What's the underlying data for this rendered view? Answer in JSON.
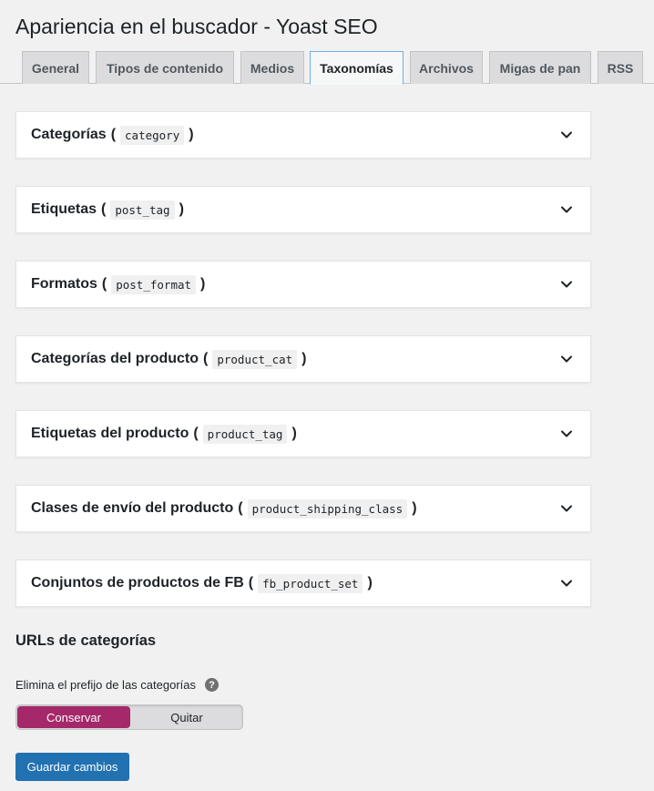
{
  "page": {
    "title": "Apariencia en el buscador - Yoast SEO"
  },
  "tabs": [
    {
      "label": "General"
    },
    {
      "label": "Tipos de contenido"
    },
    {
      "label": "Medios"
    },
    {
      "label": "Taxonomías",
      "active": true
    },
    {
      "label": "Archivos"
    },
    {
      "label": "Migas de pan"
    },
    {
      "label": "RSS"
    }
  ],
  "panels": [
    {
      "label": "Categorías",
      "slug": "category"
    },
    {
      "label": "Etiquetas",
      "slug": "post_tag"
    },
    {
      "label": "Formatos",
      "slug": "post_format"
    },
    {
      "label": "Categorías del producto",
      "slug": "product_cat"
    },
    {
      "label": "Etiquetas del producto",
      "slug": "product_tag"
    },
    {
      "label": "Clases de envío del producto",
      "slug": "product_shipping_class"
    },
    {
      "label": "Conjuntos de productos de FB",
      "slug": "fb_product_set"
    }
  ],
  "category_urls": {
    "title": "URLs de categorías",
    "field_label": "Elimina el prefijo de las categorías",
    "help_glyph": "?",
    "toggle": {
      "on_label": "Conservar",
      "off_label": "Quitar",
      "selected": "Conservar"
    }
  },
  "save_label": "Guardar cambios",
  "colors": {
    "accent_toggle": "#a4286a",
    "primary_button": "#2271b1",
    "active_tab_border": "#72aee6"
  },
  "icons": {
    "panel_toggle": "chevron-down-icon",
    "help": "help-icon"
  }
}
